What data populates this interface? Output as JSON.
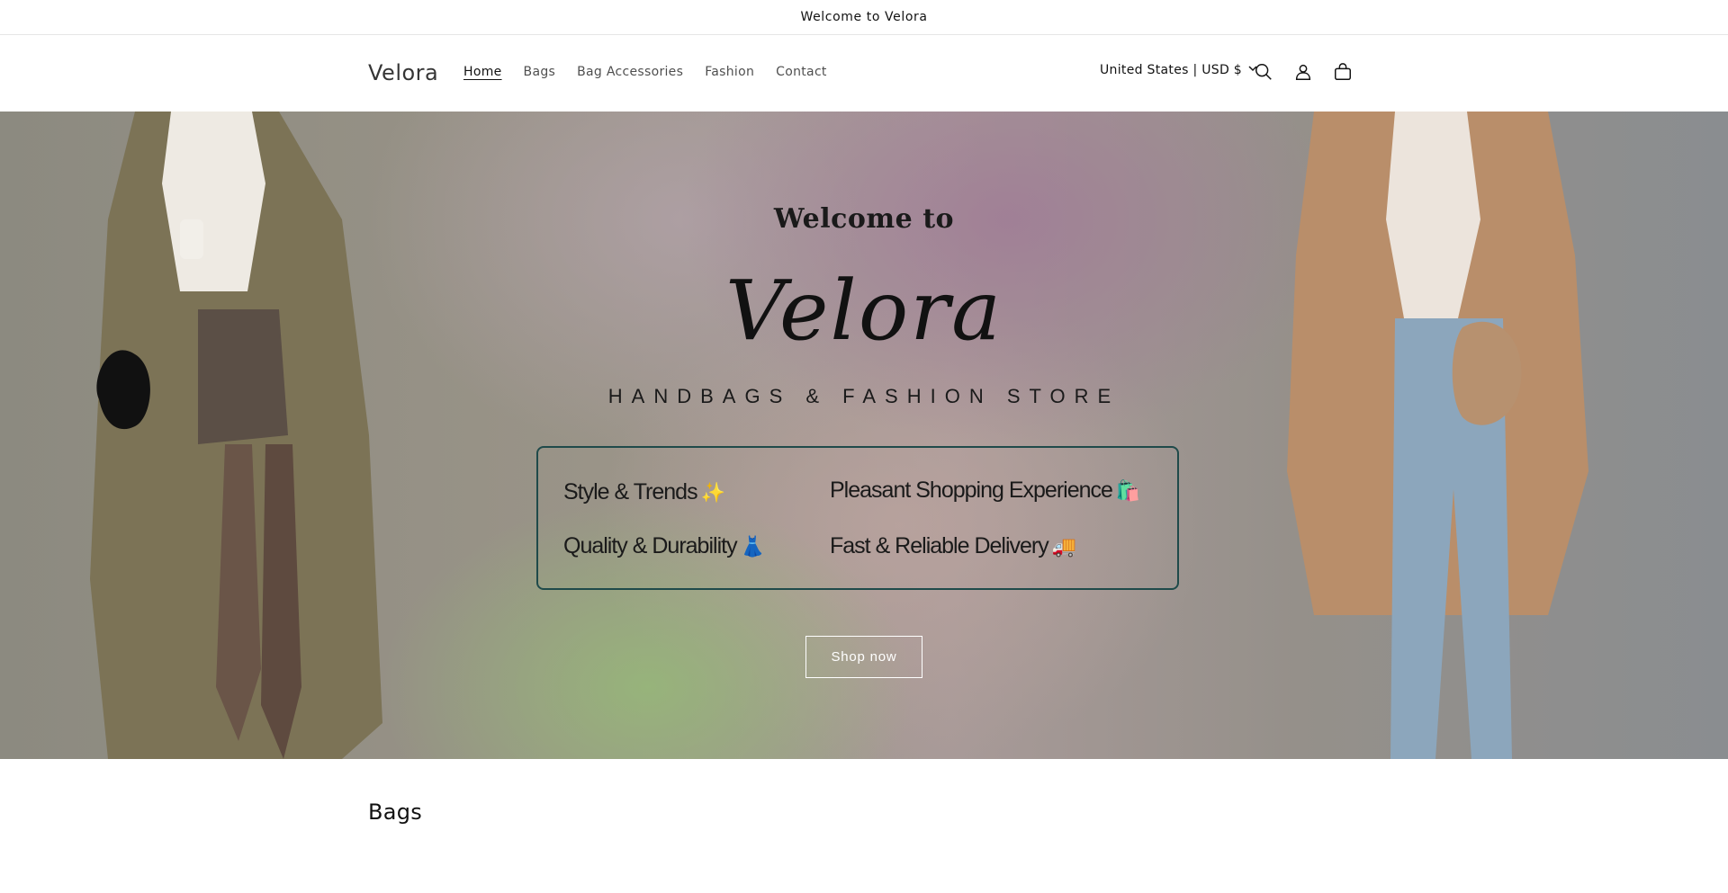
{
  "announcement": {
    "text": "Welcome to Velora"
  },
  "header": {
    "logo": "Velora",
    "nav": [
      {
        "label": "Home",
        "active": true
      },
      {
        "label": "Bags",
        "active": false
      },
      {
        "label": "Bag Accessories",
        "active": false
      },
      {
        "label": "Fashion",
        "active": false
      },
      {
        "label": "Contact",
        "active": false
      }
    ],
    "locale": "United States | USD $",
    "icons": [
      "search-icon",
      "account-icon",
      "cart-icon"
    ]
  },
  "hero": {
    "welcome": "Welcome to",
    "brand": "Velora",
    "tagline": "HANDBAGS & FASHION STORE",
    "features": [
      {
        "label": "Style & Trends",
        "emoji": "✨"
      },
      {
        "label": "Pleasant Shopping Experience",
        "emoji": "🛍️"
      },
      {
        "label": "Quality & Durability",
        "emoji": "👗"
      },
      {
        "label": "Fast & Reliable Delivery",
        "emoji": "🚚"
      }
    ],
    "cta": "Shop now"
  },
  "sections": {
    "bags_title": "Bags"
  },
  "colors": {
    "accent_border": "#1f4a4a",
    "text": "#121212"
  }
}
